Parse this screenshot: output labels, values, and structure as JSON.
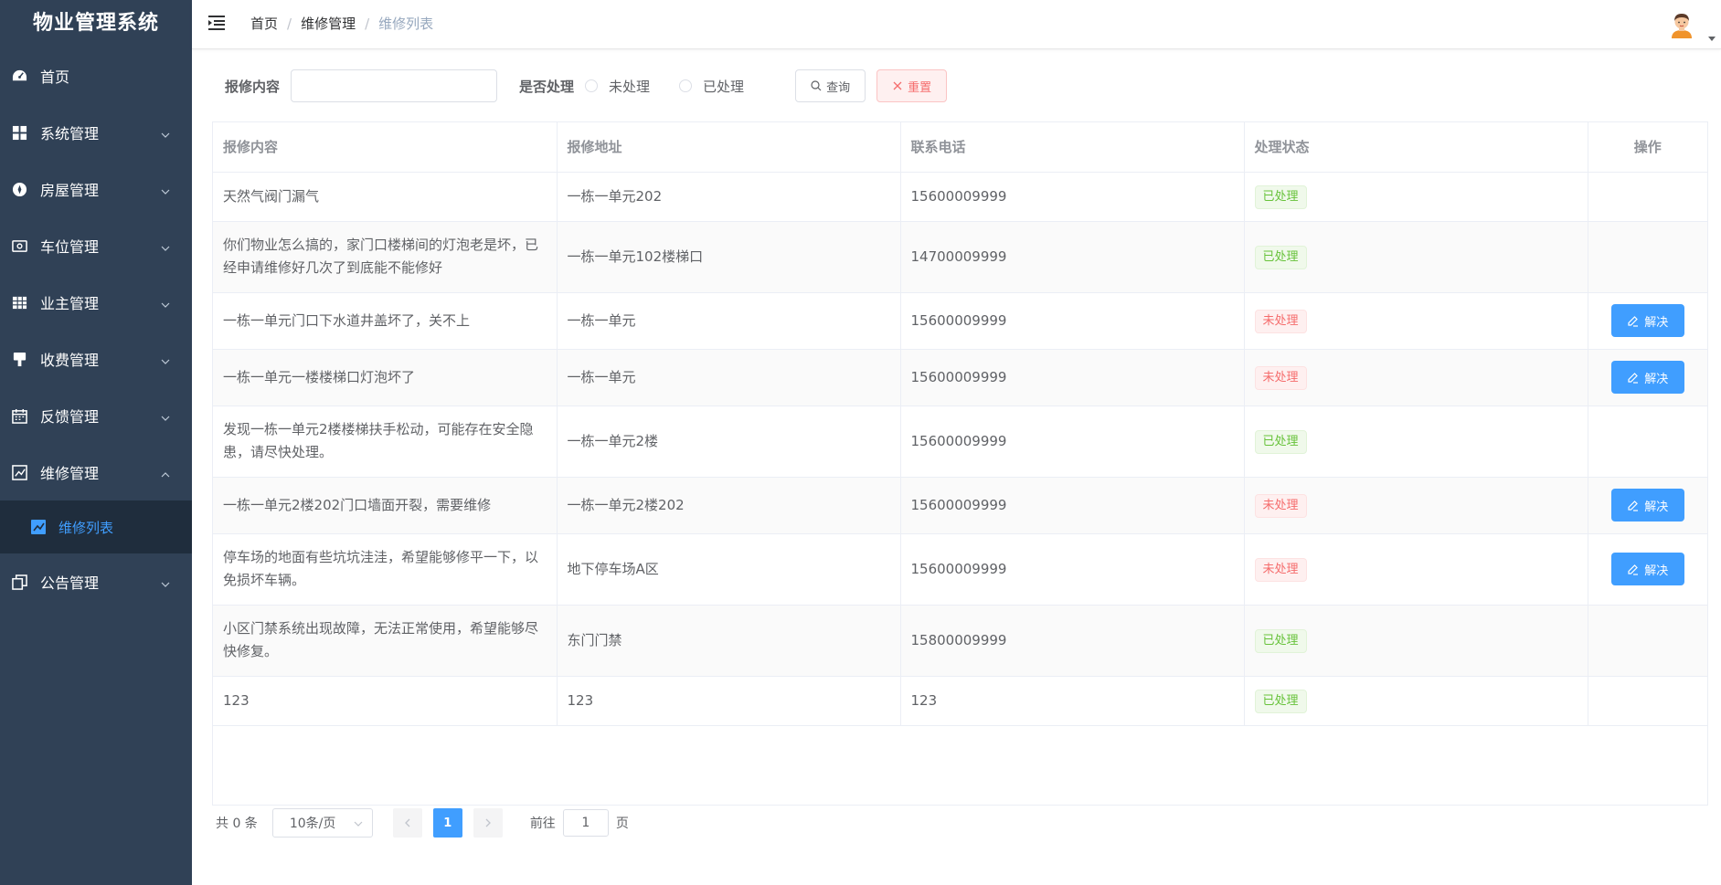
{
  "app": {
    "title": "物业管理系统"
  },
  "sidebar": {
    "items": [
      {
        "label": "首页",
        "icon": "dashboard-icon"
      },
      {
        "label": "系统管理",
        "icon": "grid-icon"
      },
      {
        "label": "房屋管理",
        "icon": "compass-icon"
      },
      {
        "label": "车位管理",
        "icon": "money-icon"
      },
      {
        "label": "业主管理",
        "icon": "table-icon"
      },
      {
        "label": "收费管理",
        "icon": "brush-icon"
      },
      {
        "label": "反馈管理",
        "icon": "calendar-icon"
      },
      {
        "label": "维修管理",
        "icon": "chart-icon"
      }
    ],
    "subitem": {
      "label": "维修列表",
      "icon": "chart-filled-icon"
    },
    "last_item": {
      "label": "公告管理",
      "icon": "copy-icon"
    }
  },
  "header": {
    "breadcrumb": [
      "首页",
      "维修管理",
      "维修列表"
    ],
    "separator": "/"
  },
  "search": {
    "content_label": "报修内容",
    "content_value": "",
    "status_label": "是否处理",
    "radio_unprocessed": "未处理",
    "radio_processed": "已处理",
    "query_button": "查询",
    "reset_button": "重置"
  },
  "table": {
    "headers": [
      "报修内容",
      "报修地址",
      "联系电话",
      "处理状态",
      "操作"
    ],
    "action_label": "解决",
    "rows": [
      {
        "content": "天然气阀门漏气",
        "address": "一栋一单元202",
        "phone": "15600009999",
        "status": "已处理",
        "solvable": false
      },
      {
        "content": "你们物业怎么搞的，家门口楼梯间的灯泡老是坏，已经申请维修好几次了到底能不能修好",
        "address": "一栋一单元102楼梯口",
        "phone": "14700009999",
        "status": "已处理",
        "solvable": false
      },
      {
        "content": "一栋一单元门口下水道井盖坏了，关不上",
        "address": "一栋一单元",
        "phone": "15600009999",
        "status": "未处理",
        "solvable": true
      },
      {
        "content": "一栋一单元一楼楼梯口灯泡坏了",
        "address": "一栋一单元",
        "phone": "15600009999",
        "status": "未处理",
        "solvable": true
      },
      {
        "content": "发现一栋一单元2楼楼梯扶手松动，可能存在安全隐患，请尽快处理。",
        "address": "一栋一单元2楼",
        "phone": "15600009999",
        "status": "已处理",
        "solvable": false
      },
      {
        "content": "一栋一单元2楼202门口墙面开裂，需要维修",
        "address": "一栋一单元2楼202",
        "phone": "15600009999",
        "status": "未处理",
        "solvable": true
      },
      {
        "content": "停车场的地面有些坑坑洼洼，希望能够修平一下，以免损坏车辆。",
        "address": "地下停车场A区",
        "phone": "15600009999",
        "status": "未处理",
        "solvable": true
      },
      {
        "content": "小区门禁系统出现故障，无法正常使用，希望能够尽快修复。",
        "address": "东门门禁",
        "phone": "15800009999",
        "status": "已处理",
        "solvable": false
      },
      {
        "content": "123",
        "address": "123",
        "phone": "123",
        "status": "已处理",
        "solvable": false
      }
    ]
  },
  "pagination": {
    "total": "共 0 条",
    "page_size": "10条/页",
    "current_page": "1",
    "goto_prefix": "前往",
    "goto_value": "1",
    "goto_suffix": "页"
  },
  "colors": {
    "sidebar_bg": "#304156",
    "active_bg": "#1f2d3d",
    "primary": "#409eff",
    "success": "#67c23a",
    "danger": "#f56c6c"
  }
}
